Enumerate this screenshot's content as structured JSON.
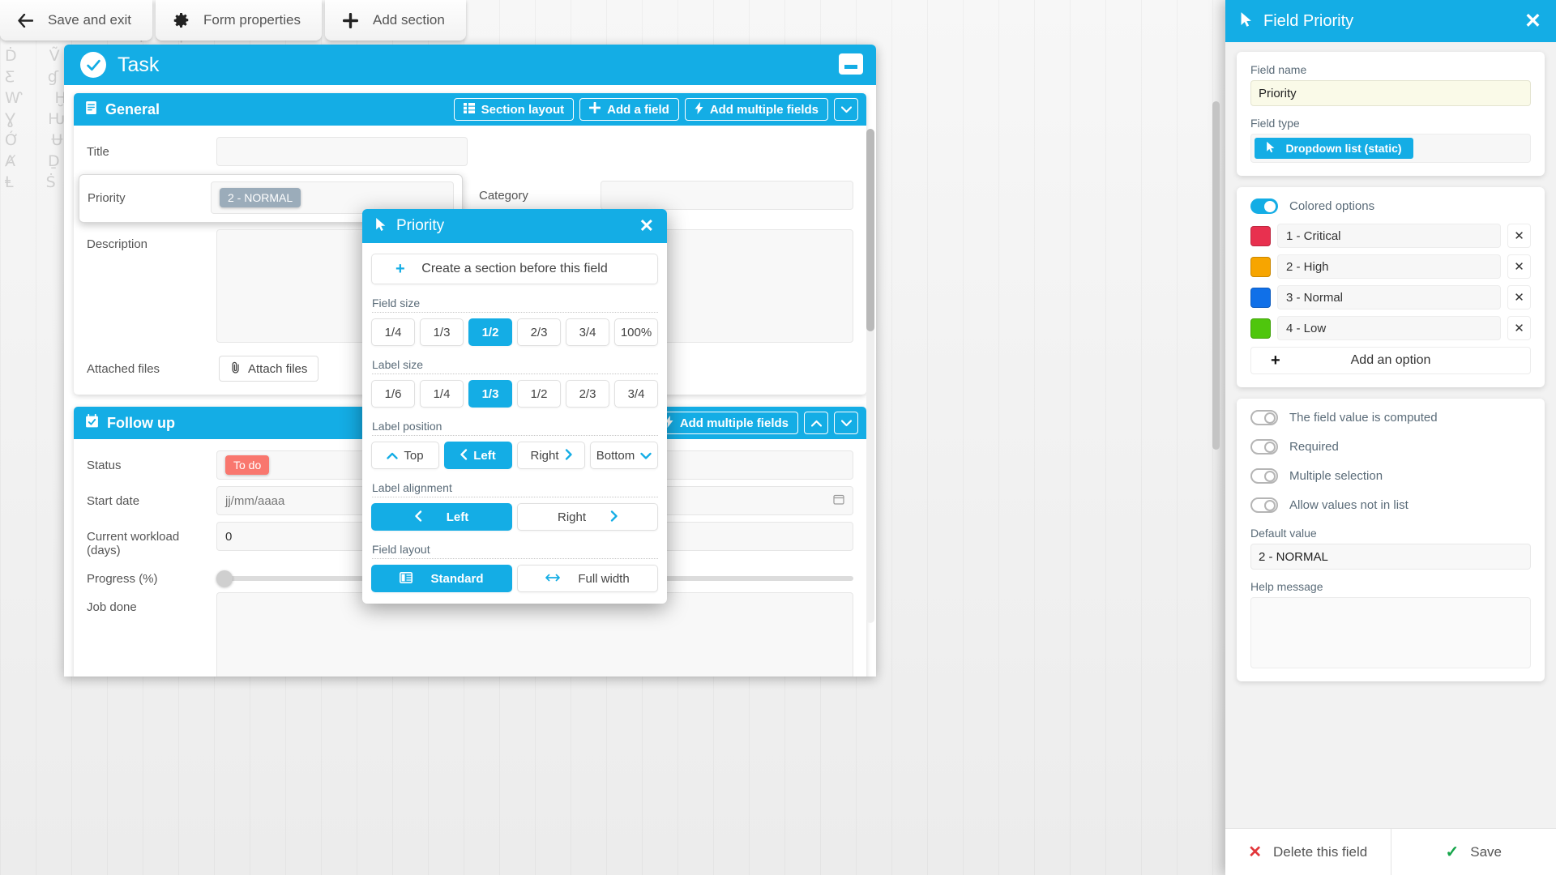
{
  "toolbar": {
    "buttons": [
      {
        "icon": "arrow-left-icon",
        "glyph": "←",
        "label": "Save and exit"
      },
      {
        "icon": "gear-icon",
        "glyph": "⚙",
        "label": "Form properties"
      },
      {
        "icon": "plus-icon",
        "glyph": "➕",
        "label": "Add section"
      }
    ]
  },
  "form": {
    "title": "Task",
    "check_glyph": "✔",
    "collapse_name": "collapse-form-button",
    "sections": [
      {
        "name": "General",
        "icon_glyph": "Ὄ4",
        "actions": {
          "section_layout": "Section layout",
          "add_field": "Add a field",
          "add_multiple_fields": "Add multiple fields",
          "chevron": "▾"
        },
        "fields": [
          {
            "label": "Title",
            "value": ""
          },
          {
            "label": "Priority",
            "value": "2 - NORMAL",
            "pill": true,
            "selected": true
          },
          {
            "label": "Category",
            "value": ""
          },
          {
            "label": "Description",
            "value": ""
          }
        ],
        "attached_files_label": "Attached files",
        "attach_button": "Attach files"
      },
      {
        "name": "Follow up",
        "icon_glyph": "Ὕ3",
        "actions": {
          "add_multiple_fields": "Add multiple fields",
          "up": "▲",
          "down": "▼"
        },
        "fields": [
          {
            "label": "Status",
            "value": "To do",
            "pill": true
          },
          {
            "label": "Start date",
            "value": "jj/mm/aaaa"
          },
          {
            "label": "Current workload (days)",
            "value": "0"
          },
          {
            "label": "Progress (%)",
            "value": ""
          },
          {
            "label": "Job done",
            "value": ""
          }
        ]
      }
    ]
  },
  "modal": {
    "title": "Priority",
    "cursor_glyph": "➤",
    "close": "✕",
    "create_section": "Create a section before this field",
    "groups": [
      {
        "label": "Field size",
        "options": [
          {
            "label": "1/4",
            "active": false
          },
          {
            "label": "1/3",
            "active": false
          },
          {
            "label": "1/2",
            "active": true
          },
          {
            "label": "2/3",
            "active": false
          },
          {
            "label": "3/4",
            "active": false
          },
          {
            "label": "100%",
            "active": false
          }
        ]
      },
      {
        "label": "Label size",
        "options": [
          {
            "label": "1/6",
            "active": false
          },
          {
            "label": "1/4",
            "active": false
          },
          {
            "label": "1/3",
            "active": true
          },
          {
            "label": "1/2",
            "active": false
          },
          {
            "label": "2/3",
            "active": false
          },
          {
            "label": "3/4",
            "active": false
          }
        ]
      },
      {
        "label": "Label position",
        "options": [
          {
            "label": "Top",
            "active": false,
            "icon": "chevron-up-icon",
            "icon_pos": "before",
            "glyph": "⌃"
          },
          {
            "label": "Left",
            "active": true,
            "icon": "chevron-left-icon",
            "icon_pos": "before",
            "glyph": "‹"
          },
          {
            "label": "Right",
            "active": false,
            "icon": "chevron-right-icon",
            "icon_pos": "after",
            "glyph": "›"
          },
          {
            "label": "Bottom",
            "active": false,
            "icon": "chevron-down-icon",
            "icon_pos": "after",
            "glyph": "⌄"
          }
        ]
      },
      {
        "label": "Label alignment",
        "options": [
          {
            "label": "Left",
            "active": true,
            "icon": "chevron-left-icon",
            "icon_pos": "before",
            "glyph": "‹"
          },
          {
            "label": "Right",
            "active": false,
            "icon": "chevron-right-icon",
            "icon_pos": "after",
            "glyph": "›"
          }
        ]
      },
      {
        "label": "Field layout",
        "options": [
          {
            "label": "Standard",
            "active": true,
            "icon": "columns-icon",
            "icon_pos": "before",
            "glyph": "▤"
          },
          {
            "label": "Full width",
            "active": false,
            "icon": "arrows-horizontal-icon",
            "icon_pos": "before",
            "glyph": "↔"
          }
        ]
      }
    ]
  },
  "panel": {
    "title": "Field Priority",
    "cursor_glyph": "➤",
    "close": "✕",
    "field_name_label": "Field name",
    "field_name_value": "Priority",
    "field_type_label": "Field type",
    "field_type_value": "Dropdown list (static)",
    "colored_options_label": "Colored options",
    "colored_options_on": true,
    "options": [
      {
        "color": "#e8304f",
        "label": "1 - Critical",
        "delete": "✕"
      },
      {
        "color": "#f7a500",
        "label": "2 - High",
        "delete": "✕"
      },
      {
        "color": "#1070e8",
        "label": "3 - Normal",
        "delete": "✕"
      },
      {
        "color": "#4fc60d",
        "label": "4 - Low",
        "delete": "✕"
      }
    ],
    "add_option_label": "Add an option",
    "toggles": [
      {
        "label": "The field value is computed",
        "on": false
      },
      {
        "label": "Required",
        "on": false
      },
      {
        "label": "Multiple selection",
        "on": false
      },
      {
        "label": "Allow values not in list",
        "on": false
      }
    ],
    "default_value_label": "Default value",
    "default_value": "2 - NORMAL",
    "help_message_label": "Help message",
    "help_message_value": "",
    "delete_button": "Delete this field",
    "save_button": "Save"
  },
  "colors": {
    "accent": "#14ade5",
    "danger": "#e2373b",
    "success": "#15a54a"
  },
  "background_glyphs": "ẄỶ Ȿ Ɋ Ḽ Ŷ Ƌ Ⱥ ể Ɏ\nＸ Ƀ Ʌ ¦ Ṩ Ᵽ Ǿ ǖ Ű\nḊ Ṽ ǂ ṏ Ḁ Ó ṹ Ḿ Ⱨ\nƸ ɠ Ț Ů Ǟ Ṋ Ⱶ Ạ Ň\nⱲ Ḫ Ɇ ḯ Ḅ Ṛ Ǽ Ǫ Ḻ\nƔ Ƕ Ỳ Ḇ Ż ẞ Ṍ Ṧ Ṕ\nỚ Ʉ ǰ Ḽ Ꞁ Ȯ Ǵ Ḷ Ǥ\nȺ Ḏ Ɖ Ẁ Ṝ Ɣ Ṉ Ḩ Ʊ\nⱠ Ṡ Ḽ ǧ Ɵ Ṋ Ẃ Ț Ȣ"
}
